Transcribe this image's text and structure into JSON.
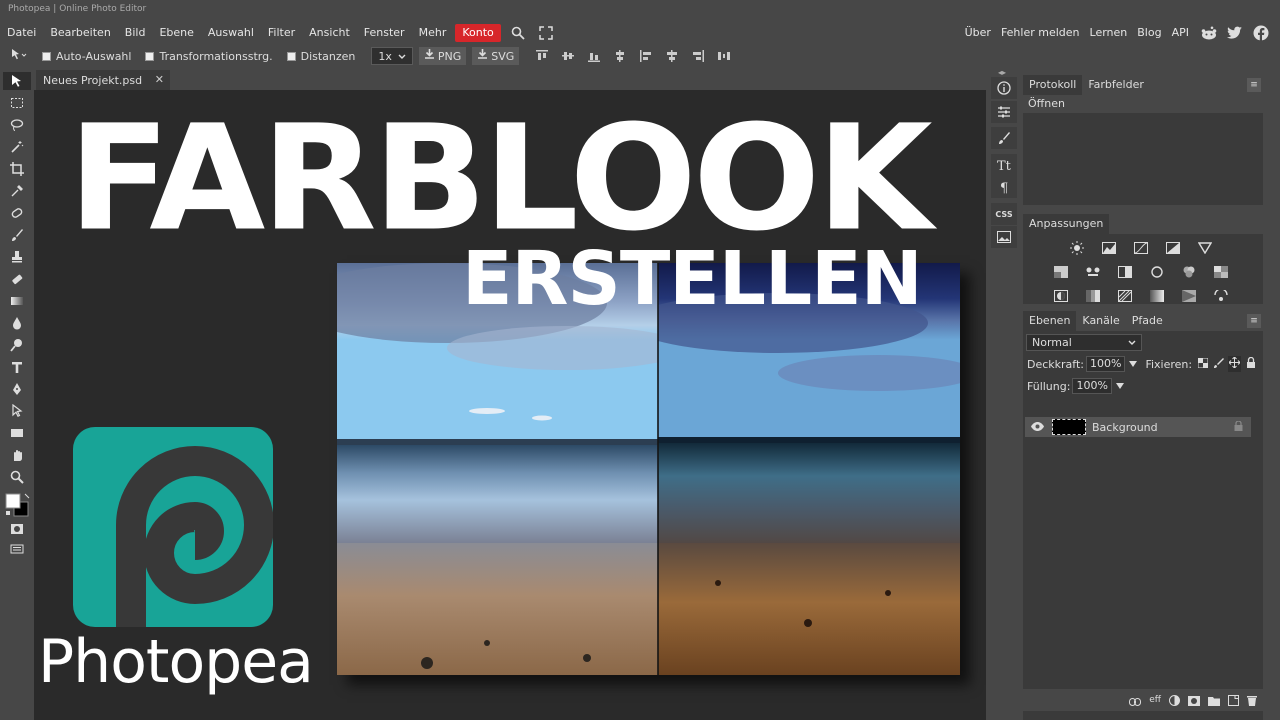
{
  "title": "Photopea | Online Photo Editor",
  "menu": {
    "items": [
      "Datei",
      "Bearbeiten",
      "Bild",
      "Ebene",
      "Auswahl",
      "Filter",
      "Ansicht",
      "Fenster",
      "Mehr"
    ],
    "account": "Konto",
    "right_items": [
      "Über",
      "Fehler melden",
      "Lernen",
      "Blog",
      "API"
    ]
  },
  "options": {
    "auto_select": "Auto-Auswahl",
    "transform": "Transformationsstrg.",
    "distances": "Distanzen",
    "zoom": "1x",
    "png": "PNG",
    "svg": "SVG"
  },
  "document": {
    "tab_name": "Neues Projekt.psd",
    "close": "✕",
    "headline": "FARBLOOK",
    "subhead": "ERSTELLEN",
    "logo_word": "Photopea"
  },
  "panels": {
    "history_tab": "Protokoll",
    "swatches_tab": "Farbfelder",
    "history_item": "Öffnen",
    "adjustments_tab": "Anpassungen",
    "layers_tab": "Ebenen",
    "channels_tab": "Kanäle",
    "paths_tab": "Pfade",
    "blend_mode": "Normal",
    "opacity_label": "Deckkraft:",
    "opacity_value": "100%",
    "lock_label": "Fixieren:",
    "fill_label": "Füllung:",
    "fill_value": "100%",
    "layer_name": "Background",
    "css_label": "CSS"
  },
  "colors": {
    "accent": "#d7262a",
    "logo": "#18a497",
    "bg": "#474747",
    "canvas": "#2a2a2a"
  }
}
